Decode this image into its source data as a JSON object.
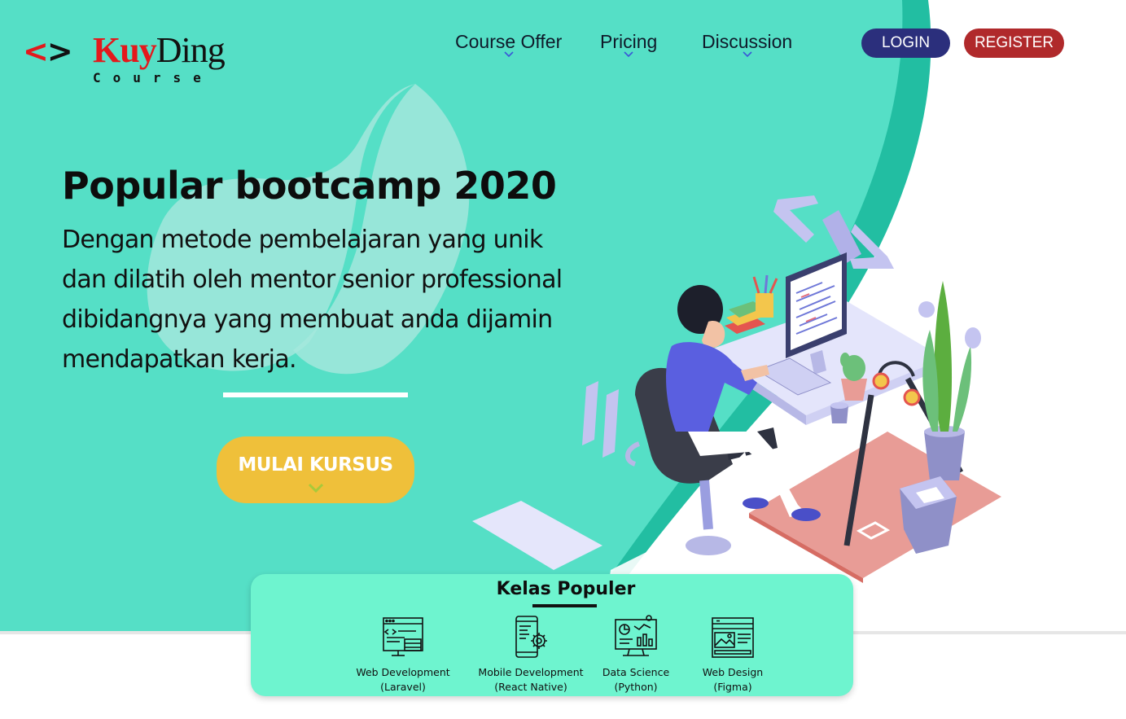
{
  "brand": {
    "mark": "<>",
    "name_part1": "Kuy",
    "name_part2": "Ding",
    "subtitle": "Course",
    "colors": {
      "red": "#e3191c",
      "dark": "#111111"
    }
  },
  "nav": {
    "items": [
      {
        "label": "Course Offer",
        "icon": "chevron-down-icon"
      },
      {
        "label": "Pricing",
        "icon": "chevron-down-icon"
      },
      {
        "label": "Discussion",
        "icon": "chevron-down-icon"
      }
    ],
    "login_label": "LOGIN",
    "register_label": "REGISTER"
  },
  "hero": {
    "title": "Popular bootcamp 2020",
    "description_lines": [
      "Dengan metode pembelajaran yang unik",
      "dan dilatih oleh mentor senior professional",
      "dibidangnya yang membuat anda dijamin",
      "mendapatkan kerja."
    ],
    "cta_label": "MULAI KURSUS"
  },
  "popular": {
    "title": "Kelas Populer",
    "courses": [
      {
        "name": "Web Development",
        "sub": "(Laravel)",
        "icon": "web-development-icon"
      },
      {
        "name": "Mobile Development",
        "sub": "(React Native)",
        "icon": "mobile-development-icon"
      },
      {
        "name": "Data Science",
        "sub": "(Python)",
        "icon": "data-science-icon"
      },
      {
        "name": "Web Design",
        "sub": "(Figma)",
        "icon": "web-design-icon"
      }
    ]
  },
  "colors": {
    "hero_bg": "#55dfc6",
    "hero_arc": "#22bea2",
    "card_bg": "#6ef4cf",
    "cta": "#efc03a",
    "login": "#2b2f7c",
    "register": "#b0292b"
  }
}
